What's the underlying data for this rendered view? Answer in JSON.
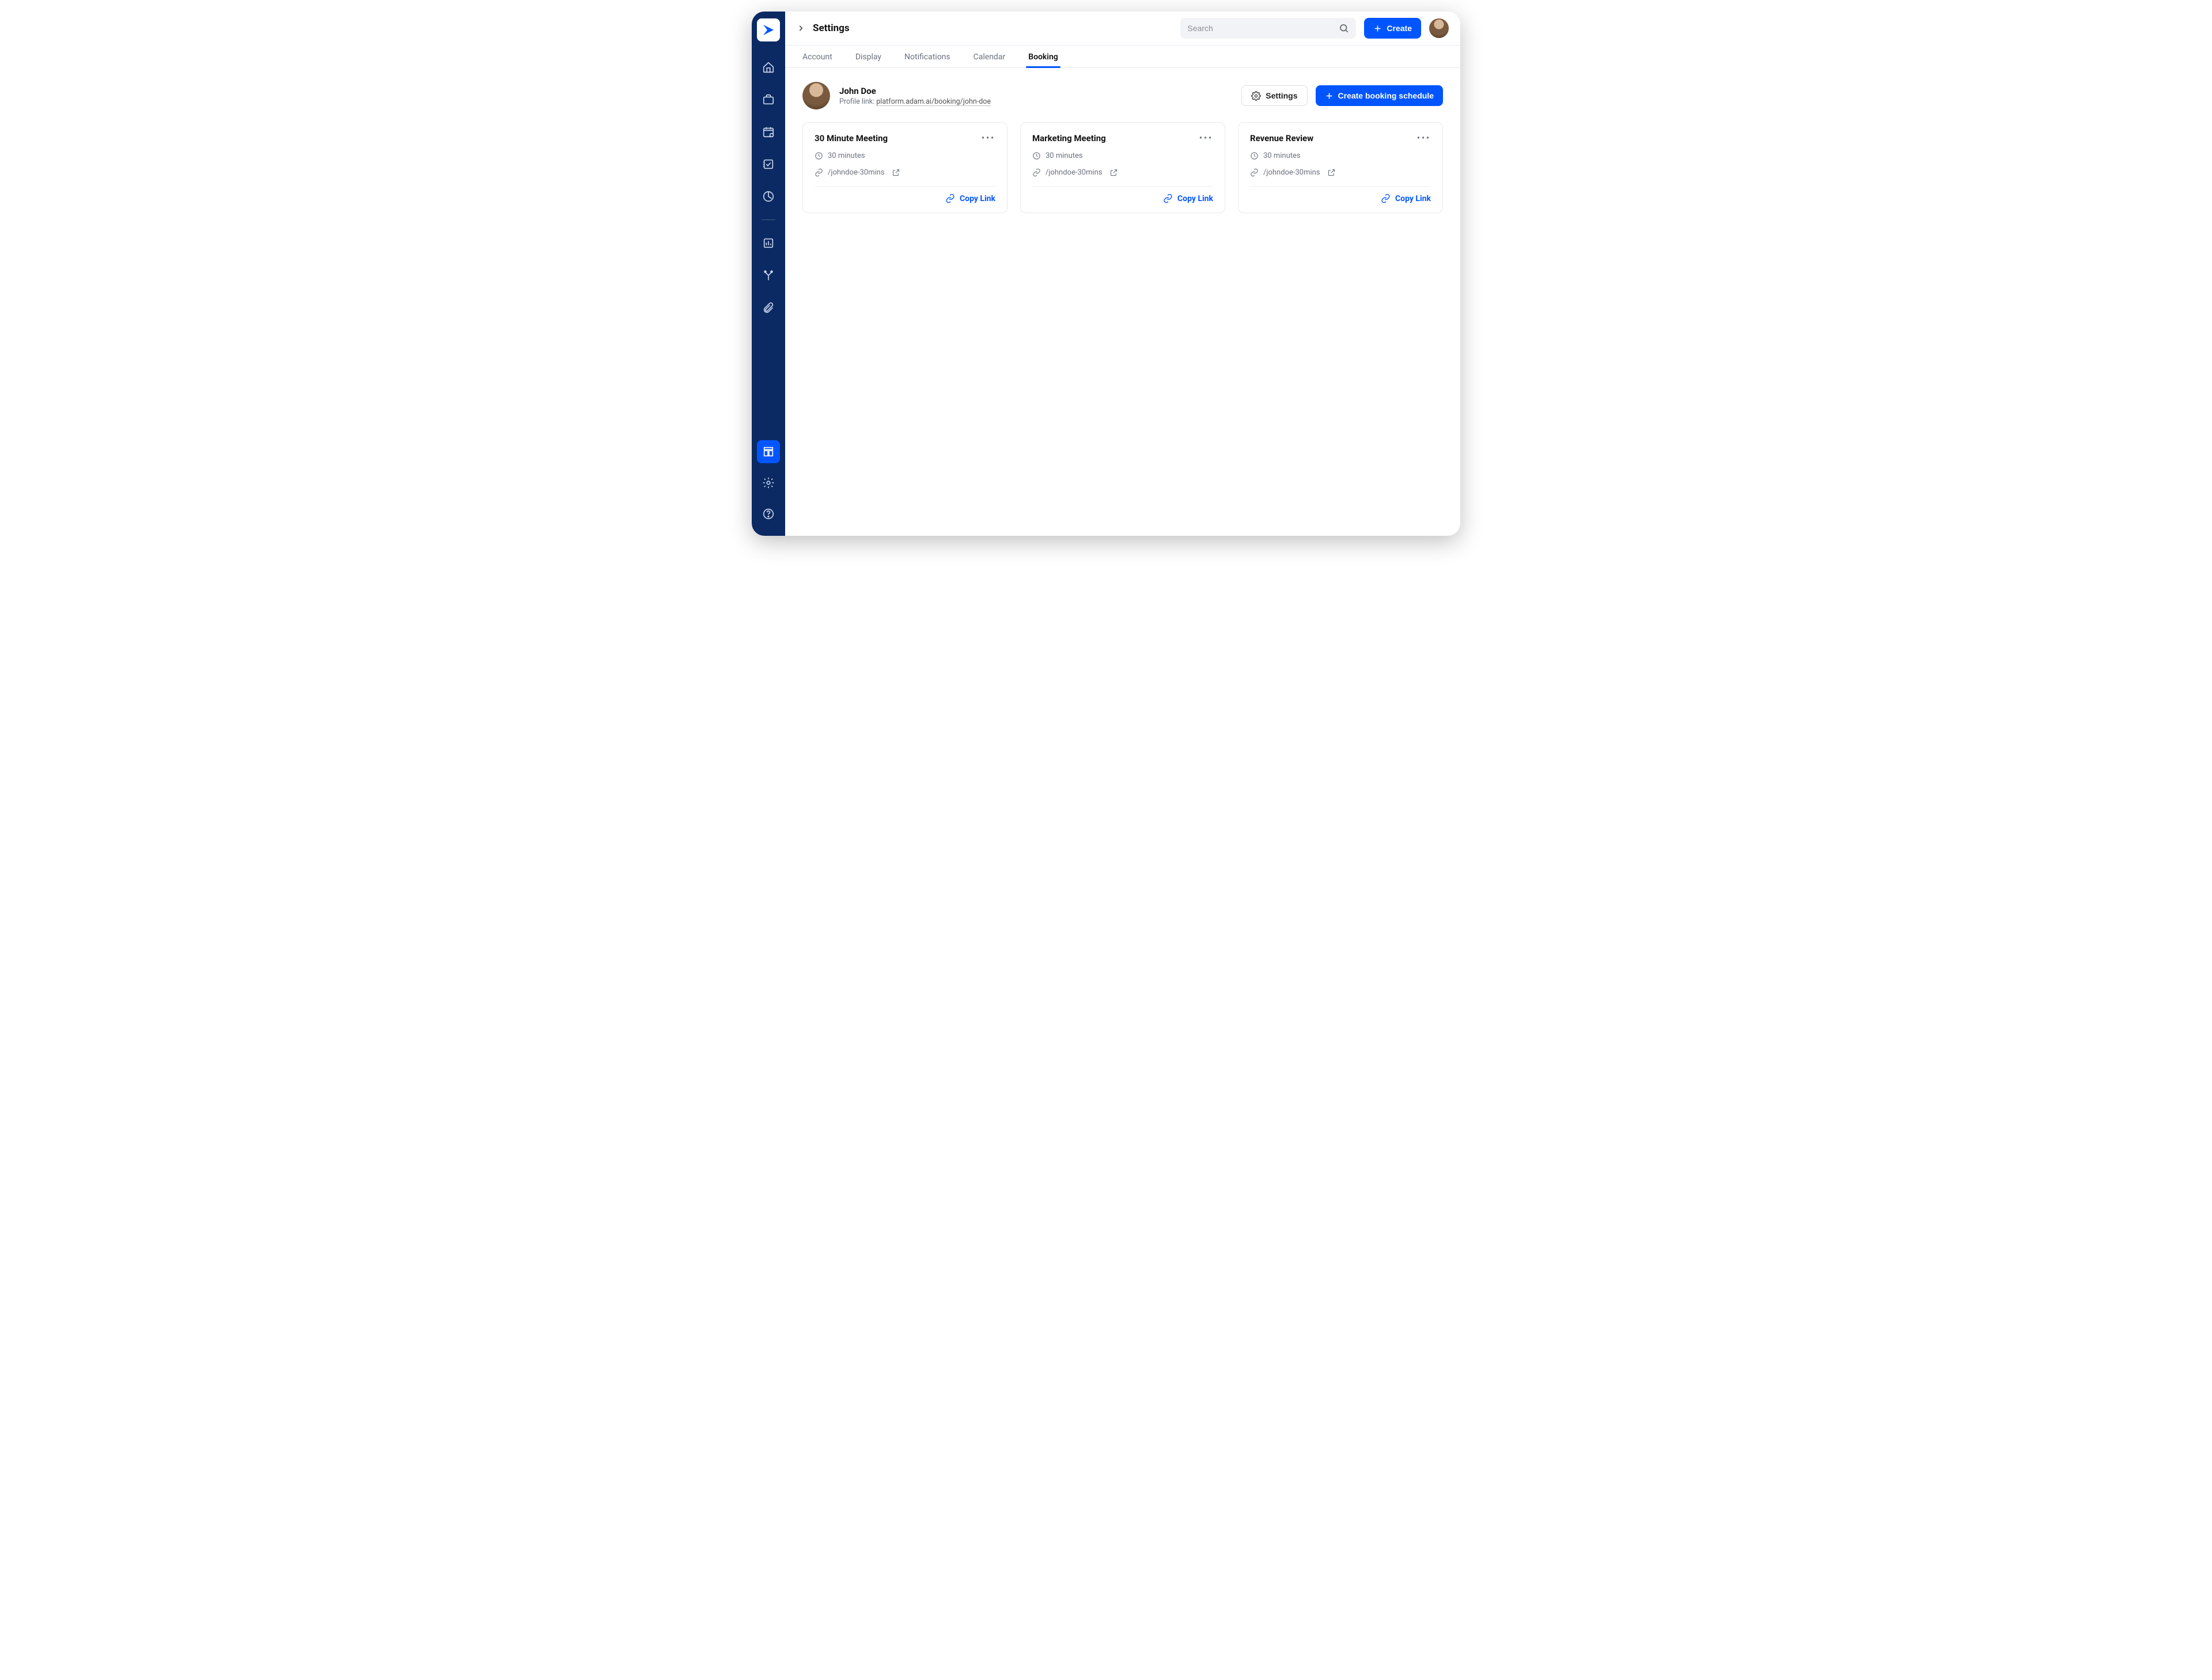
{
  "header": {
    "page_title": "Settings",
    "search_placeholder": "Search",
    "create_label": "Create"
  },
  "tabs": [
    {
      "label": "Account"
    },
    {
      "label": "Display"
    },
    {
      "label": "Notifications"
    },
    {
      "label": "Calendar"
    },
    {
      "label": "Booking"
    }
  ],
  "active_tab_index": 4,
  "profile": {
    "name": "John Doe",
    "link_prefix": "Profile link:",
    "link_value": "platform.adam.ai/booking/john-doe",
    "settings_label": "Settings",
    "create_schedule_label": "Create booking schedule"
  },
  "cards": [
    {
      "title": "30 Minute Meeting",
      "duration": "30 minutes",
      "path": "/johndoe-30mins",
      "copy_label": "Copy Link"
    },
    {
      "title": "Marketing Meeting",
      "duration": "30 minutes",
      "path": "/johndoe-30mins",
      "copy_label": "Copy Link"
    },
    {
      "title": "Revenue Review",
      "duration": "30 minutes",
      "path": "/johndoe-30mins",
      "copy_label": "Copy Link"
    }
  ]
}
